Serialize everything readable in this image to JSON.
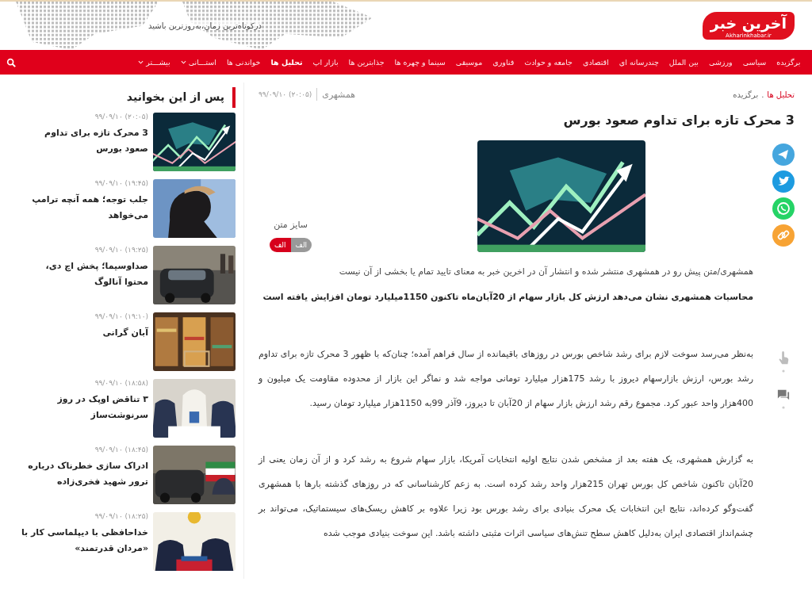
{
  "header": {
    "logo_text": "آخرین خبر",
    "logo_domain": "Akharinkhabar.ir",
    "tagline": "درکوتاه‌ترین زمان،به‌روزترین باشید"
  },
  "nav": [
    {
      "label": "برگزیده",
      "selected": false,
      "dropdown": false
    },
    {
      "label": "سیاسی",
      "selected": false,
      "dropdown": false
    },
    {
      "label": "ورزشی",
      "selected": false,
      "dropdown": false
    },
    {
      "label": "بین الملل",
      "selected": false,
      "dropdown": false
    },
    {
      "label": "چندرسانه ای",
      "selected": false,
      "dropdown": false
    },
    {
      "label": "اقتصادی",
      "selected": false,
      "dropdown": false
    },
    {
      "label": "جامعه و حوادث",
      "selected": false,
      "dropdown": false
    },
    {
      "label": "فناوری",
      "selected": false,
      "dropdown": false
    },
    {
      "label": "موسیقی",
      "selected": false,
      "dropdown": false
    },
    {
      "label": "سینما و چهره ها",
      "selected": false,
      "dropdown": false
    },
    {
      "label": "جذابترین ها",
      "selected": false,
      "dropdown": false
    },
    {
      "label": "بازار اپ",
      "selected": false,
      "dropdown": false
    },
    {
      "label": "تحلیل ها",
      "selected": true,
      "dropdown": false
    },
    {
      "label": "خواندنی ها",
      "selected": false,
      "dropdown": false
    },
    {
      "label": "استـــانی",
      "selected": false,
      "dropdown": true
    },
    {
      "label": "بیشـــتر",
      "selected": false,
      "dropdown": true
    }
  ],
  "article": {
    "breadcrumb": [
      "تحلیل ها",
      "برگزیده"
    ],
    "breadcrumb_separator": ".",
    "source": "همشهری",
    "date": "(۲۰:۰۵) ۹۹/۰۹/۱۰",
    "title": "3 محرک تازه برای تداوم صعود بورس",
    "text_size": {
      "label": "سایز متن",
      "options": [
        {
          "label": "الف",
          "selected": false
        },
        {
          "label": "الف",
          "selected": true
        }
      ]
    },
    "lead": "همشهری/متن پیش رو در همشهری منتشر شده و انتشار آن در اخرین خبر به معنای تایید تمام یا بخشی از آن نیست",
    "summary": "محاسبات همشهری نشان می‌دهد ارزش کل بازار سهام از 20آبان‌ماه تاکنون 1150میلیارد تومان افزایش یافته است",
    "paragraphs": [
      "به‌نظر می‌رسد سوخت لازم برای رشد شاخص بورس در روزهای باقیمانده از سال فراهم آمده؛ چنان‌که با ظهور 3 محرک تازه برای تداوم رشد بورس، ارزش بازارسهام دیروز با رشد 175هزار میلیارد تومانی مواجه شد و نماگر این بازار از محدوده مقاومت یک میلیون و 400هزار واحد عبور کرد. مجموع رقم رشد ارزش بازار سهام از 20آبان تا دیروز، 9آذر 99به 1150هزار میلیارد تومان رسید.",
      "به گزارش همشهری، یک هفته بعد از مشخص شدن نتایج اولیه انتخابات آمریکا، بازار سهام شروع به رشد کرد و از آن زمان یعنی از 20آبان تاکنون شاخص کل بورس تهران 215هزار واحد رشد کرده است. به زعم کارشناسانی که در روزهای گذشته بارها با همشهری گفت‌وگو کرده‌اند، نتایج این انتخابات یک محرک بنیادی برای رشد بورس بود زیرا علاوه بر کاهش ریسک‌های سیستماتیک، می‌تواند بر چشم‌انداز اقتصادی ایران به‌دلیل کاهش سطح تنش‌های سیاسی اثرات مثبتی داشته باشد. این سوخت بنیادی موجب شده"
    ]
  },
  "sidebar": {
    "title": "پس از این بخوانید",
    "items": [
      {
        "date": "(۲۰:۰۵) ۹۹/۰۹/۱۰",
        "title": "3 محرک تازه برای تداوم صعود بورس"
      },
      {
        "date": "(۱۹:۴۵) ۹۹/۰۹/۱۰",
        "title": "جلب توجه؛ همه آنچه ترامپ می‌خواهد"
      },
      {
        "date": "(۱۹:۲۵) ۹۹/۰۹/۱۰",
        "title": "صداوسیما؛ پخش اچ دی، محتوا آنالوگ"
      },
      {
        "date": "(۱۹:۱۰) ۹۹/۰۹/۱۰",
        "title": "آبان گرانی"
      },
      {
        "date": "(۱۸:۵۸) ۹۹/۰۹/۱۰",
        "title": "۳ تناقض اوپک در روز سرنوشت‌ساز"
      },
      {
        "date": "(۱۸:۴۵) ۹۹/۰۹/۱۰",
        "title": "ادراک سازی خطرناک درباره ترور شهید فخری‌زاده"
      },
      {
        "date": "(۱۸:۲۵) ۹۹/۰۹/۱۰",
        "title": "خداحافظی با دیپلماسی کار با «مردان قدرتمند»"
      }
    ]
  }
}
